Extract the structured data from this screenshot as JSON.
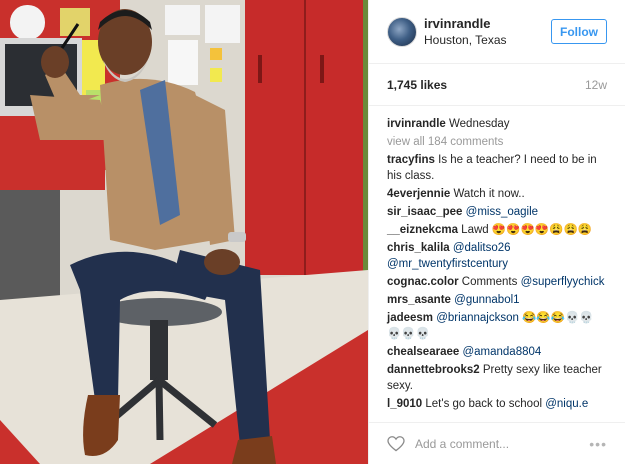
{
  "post": {
    "photo_icon": "post-photo",
    "owner": {
      "username": "irvinrandle",
      "location": "Houston, Texas",
      "avatar_icon": "avatar-icon"
    },
    "follow_label": "Follow",
    "likes": "1,745 likes",
    "age": "12w",
    "caption": {
      "username": "irvinrandle",
      "text": "Wednesday"
    },
    "view_all_label": "view all 184 comments",
    "comments": [
      {
        "user": "tracyfins",
        "text": "Is he a teacher? I need to be in his class.",
        "mention": ""
      },
      {
        "user": "4everjennie",
        "text": "Watch it now..",
        "mention": ""
      },
      {
        "user": "sir_isaac_pee",
        "text": "",
        "mention": "@miss_oagile"
      },
      {
        "user": "__eiznekcma",
        "text": "Lawd 😍😍😍😍😩😩😩",
        "mention": ""
      },
      {
        "user": "chris_kalila",
        "text": "",
        "mention": "@dalitso26 @mr_twentyfirstcentury"
      },
      {
        "user": "cognac.color",
        "text": "Comments",
        "mention": "@superflyychick"
      },
      {
        "user": "mrs_asante",
        "text": "",
        "mention": "@gunnabol1"
      },
      {
        "user": "jadeesm",
        "text": "",
        "mention": "@briannajckson",
        "after": "😂😂😂💀💀💀💀💀"
      },
      {
        "user": "chealsearaee",
        "text": "",
        "mention": "@amanda8804"
      },
      {
        "user": "dannettebrooks2",
        "text": "Pretty sexy like teacher sexy.",
        "mention": ""
      },
      {
        "user": "l_9010",
        "text": "Let's go back to school",
        "mention": "@niqu.e"
      }
    ],
    "add_comment_placeholder": "Add a comment...",
    "heart_icon": "heart-outline-icon",
    "more_icon": "more-options-icon",
    "more_glyph": "•••"
  }
}
